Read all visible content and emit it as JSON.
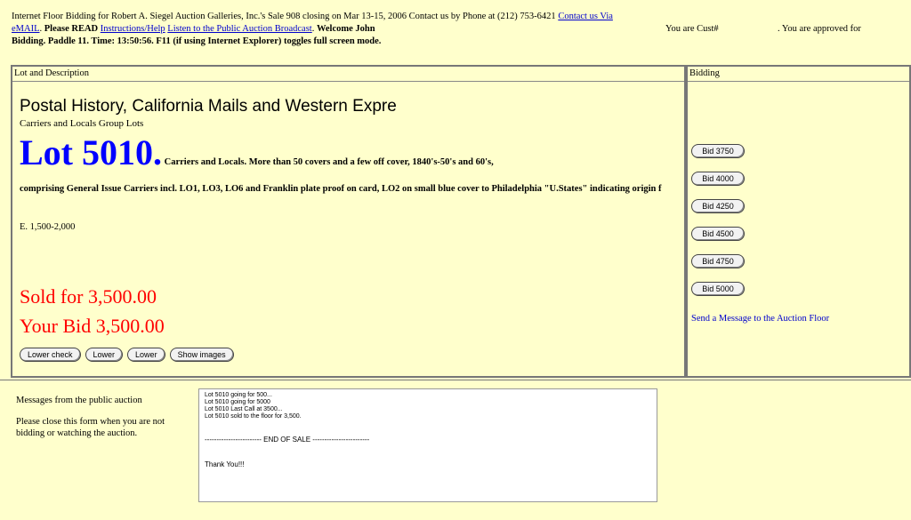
{
  "header": {
    "line1_prefix": "Internet Floor Bidding for Robert A. Siegel Auction Galleries, Inc.'s Sale 908 closing on Mar 13-15, 2006 Contact us by Phone at (212) 753-6421",
    "contact_link": "Contact us Via",
    "email_link": "eMAIL",
    "please_read": "Please READ",
    "instructions_link": "Instructions/Help",
    "listen_link": "Listen to the Public Auction Broadcast",
    "welcome": "Welcome John",
    "you_are": "You are Cust#",
    "approved": ". You are approved for",
    "line3": "Bidding. Paddle 11. Time: 13:50:56. F11 (if using Internet Explorer) toggles full screen mode."
  },
  "main": {
    "col_head": "Lot and Description",
    "category_title": "Postal History, California Mails and Western Expre",
    "subtitle": "Carriers and Locals Group Lots",
    "lot_number": "Lot 5010.",
    "desc_first": "Carriers and Locals. More than 50 covers and a few off cover, 1840's-50's and 60's,",
    "desc_rest": "comprising General Issue Carriers incl. LO1, LO3, LO6 and Franklin plate proof on card, LO2 on small blue cover to Philadelphia \"U.States\" indicating origin f",
    "estimate": "E. 1,500-2,000",
    "sold": "Sold for 3,500.00",
    "your_bid": "Your Bid 3,500.00",
    "buttons": [
      "Lower check",
      "Lower",
      "Lower",
      "Show images"
    ]
  },
  "bidding": {
    "col_head": "Bidding",
    "bid_buttons": [
      "Bid 3750",
      "Bid 4000",
      "Bid 4250",
      "Bid 4500",
      "Bid 4750",
      "Bid 5000"
    ],
    "message_link": "Send a Message to the Auction Floor"
  },
  "messages": {
    "label": "Messages from the public auction",
    "close_note": "Please close this form when you are not bidding or watching the auction.",
    "lines": [
      "Lot 5010 going for 500...",
      "Lot 5010 going for 5000",
      "Lot 5010 Last Call at 3500...",
      "Lot 5010 sold to the floor for 3,500."
    ],
    "end_of_sale": "------------------------ END OF SALE ------------------------",
    "thanks": "Thank You!!!"
  }
}
